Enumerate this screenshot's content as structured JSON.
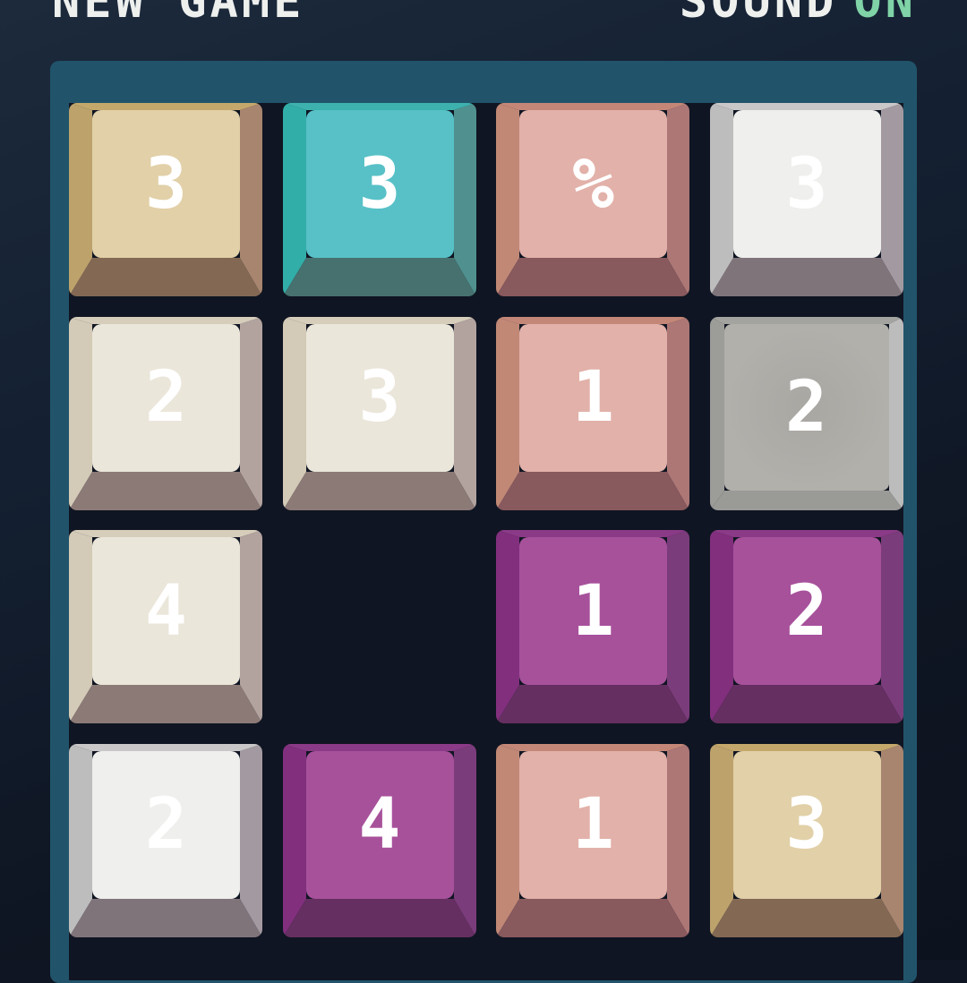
{
  "header": {
    "new_game_label": "NEW GAME",
    "sound_label": "SOUND",
    "sound_value": "ON"
  },
  "palette": {
    "tan": {
      "top": "#c4a86b",
      "left": "#bda26c",
      "right": "#a7856f",
      "bottom": "#836954",
      "face": "#e2d0a8"
    },
    "teal": {
      "top": "#3cb1ad",
      "left": "#32aea9",
      "right": "#50918f",
      "bottom": "#46716f",
      "face": "#57c1c7"
    },
    "salmon": {
      "top": "#c48777",
      "left": "#c18876",
      "right": "#ad7776",
      "bottom": "#88595d",
      "face": "#e2b1a9"
    },
    "white": {
      "top": "#c9c7c7",
      "left": "#bdbdbd",
      "right": "#a39aa1",
      "bottom": "#80747b",
      "face": "#efefed"
    },
    "cream": {
      "top": "#d6cdbb",
      "left": "#d3cab7",
      "right": "#b2a39f",
      "bottom": "#8c7a77",
      "face": "#ebe6da"
    },
    "gray": {
      "top": "#a3a39f",
      "left": "#9c9c98",
      "right": "#bdbcbd",
      "bottom": "#9a9a97",
      "face": "#b2b0ab"
    },
    "purple": {
      "top": "#8a3a86",
      "left": "#822f7e",
      "right": "#7b3c7b",
      "bottom": "#652f61",
      "face": "#a7519b"
    }
  },
  "grid": [
    [
      {
        "value": "3",
        "color": "tan"
      },
      {
        "value": "3",
        "color": "teal"
      },
      {
        "value": "%",
        "color": "salmon"
      },
      {
        "value": "3",
        "color": "white"
      }
    ],
    [
      {
        "value": "2",
        "color": "cream"
      },
      {
        "value": "3",
        "color": "cream"
      },
      {
        "value": "1",
        "color": "salmon"
      },
      {
        "value": "2",
        "color": "gray",
        "style": "flat"
      }
    ],
    [
      {
        "value": "4",
        "color": "cream"
      },
      null,
      {
        "value": "1",
        "color": "purple"
      },
      {
        "value": "2",
        "color": "purple"
      }
    ],
    [
      {
        "value": "2",
        "color": "white"
      },
      {
        "value": "4",
        "color": "purple"
      },
      {
        "value": "1",
        "color": "salmon"
      },
      {
        "value": "3",
        "color": "tan"
      }
    ]
  ]
}
